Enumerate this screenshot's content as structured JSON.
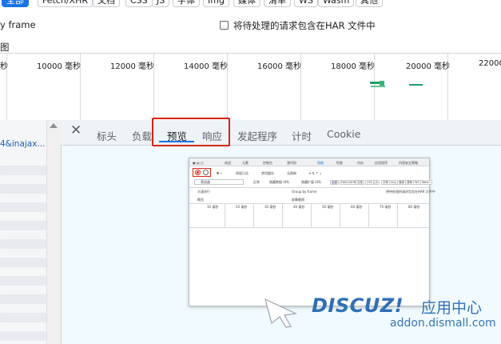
{
  "filters": {
    "chips": [
      "全部",
      "Fetch/XHR",
      "文档",
      "CSS",
      "JS",
      "字体",
      "Img",
      "媒体",
      "清单",
      "WS",
      "Wasm",
      "其他"
    ],
    "active": "全部"
  },
  "options": {
    "group_by_frame": "y frame",
    "include_pending_har": "将待处理的请求包含在HAR 文件中",
    "overview_label": "图"
  },
  "overview": {
    "labels": [
      "秒",
      "10000 毫秒",
      "12000 毫秒",
      "14000 毫秒",
      "16000 毫秒",
      "18000 毫秒",
      "20000 毫秒",
      "22000"
    ]
  },
  "requests": {
    "first_row_text": "4&inajax..."
  },
  "details": {
    "tabs": [
      "标头",
      "负载",
      "预览",
      "响应",
      "发起程序",
      "计时",
      "Cookie"
    ],
    "selected_tab": "预览"
  },
  "preview": {
    "toolbar_tabs": [
      "欢迎",
      "元素",
      "控制台",
      "源代码",
      "网络",
      "性能",
      "内存",
      "应用程序",
      "内容安全策略"
    ],
    "filter_placeholder": "筛选器",
    "checkboxes": [
      "保留日志",
      "禁用缓存",
      "无限制"
    ],
    "options": [
      "反转",
      "隐藏数据 URL",
      "隐藏扩展 URL"
    ],
    "chips": [
      "全部",
      "Fetch/XHR",
      "文档",
      "CSS",
      "JS",
      "字体",
      "Img",
      "媒体",
      "清单",
      "WS",
      "Wasm",
      "其他"
    ],
    "rows": [
      "大请求行",
      "Group by frame",
      "概览",
      "屏幕截图"
    ],
    "har_text": "将待处理的请求包含在HAR 文件中",
    "time_labels": [
      "10 毫秒",
      "20 毫秒",
      "30 毫秒",
      "40 毫秒",
      "50 毫秒",
      "60 毫秒",
      "70 毫秒",
      "80 毫秒"
    ]
  },
  "watermark": {
    "logo": "DISCUZ!",
    "cn": "应用中心",
    "url": "addon.dismall.com"
  },
  "colors": {
    "accent": "#1a73e8",
    "highlight": "#d9230f",
    "watermark": "#2f6fb4"
  }
}
